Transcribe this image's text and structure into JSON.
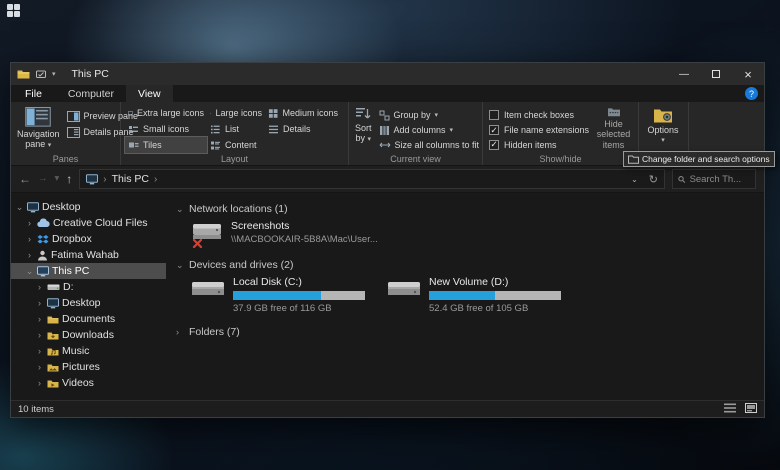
{
  "window": {
    "title": "This PC"
  },
  "tabs": {
    "file": "File",
    "computer": "Computer",
    "view": "View"
  },
  "ribbon": {
    "panes": {
      "group_label": "Panes",
      "navigation_pane": "Navigation pane",
      "preview_pane": "Preview pane",
      "details_pane": "Details pane"
    },
    "layout": {
      "group_label": "Layout",
      "extra_large_icons": "Extra large icons",
      "large_icons": "Large icons",
      "medium_icons": "Medium icons",
      "small_icons": "Small icons",
      "list": "List",
      "details": "Details",
      "tiles": "Tiles",
      "content": "Content"
    },
    "current_view": {
      "group_label": "Current view",
      "sort_by": "Sort by",
      "group_by": "Group by",
      "add_columns": "Add columns",
      "size_all_columns": "Size all columns to fit"
    },
    "show_hide": {
      "group_label": "Show/hide",
      "item_check_boxes": "Item check boxes",
      "file_name_extensions": "File name extensions",
      "hidden_items": "Hidden items",
      "hide_selected_items": "Hide selected items"
    },
    "options": {
      "label": "Options"
    }
  },
  "tooltip": {
    "text": "Change folder and search options"
  },
  "address_bar": {
    "location": "This PC",
    "search_placeholder": "Search Th..."
  },
  "sidebar": {
    "items": [
      {
        "label": "Desktop"
      },
      {
        "label": "Creative Cloud Files"
      },
      {
        "label": "Dropbox"
      },
      {
        "label": "Fatima Wahab"
      },
      {
        "label": "This PC"
      },
      {
        "label": "D:"
      },
      {
        "label": "Desktop"
      },
      {
        "label": "Documents"
      },
      {
        "label": "Downloads"
      },
      {
        "label": "Music"
      },
      {
        "label": "Pictures"
      },
      {
        "label": "Videos"
      }
    ]
  },
  "content": {
    "groups": [
      {
        "header": "Network locations (1)"
      },
      {
        "header": "Devices and drives (2)"
      },
      {
        "header": "Folders (7)"
      }
    ],
    "network_item": {
      "name": "Screenshots",
      "path": "\\\\MACBOOKAIR-5B8A\\Mac\\User..."
    },
    "drives": [
      {
        "name": "Local Disk (C:)",
        "free": "37.9 GB free of 116 GB",
        "used_pct": 67
      },
      {
        "name": "New Volume (D:)",
        "free": "52.4 GB free of 105 GB",
        "used_pct": 50
      }
    ]
  },
  "status_bar": {
    "items_count": "10 items"
  },
  "colors": {
    "accent_blue": "#26a0da",
    "selection_gray": "#4d4d4d",
    "window_bg": "#202020",
    "drive_bar_track": "#b5b5b5"
  },
  "icons": {
    "back": "←",
    "forward": "→",
    "up": "↑",
    "refresh": "↻",
    "dropdown": "⌄",
    "dropdown_small": "▾",
    "expanded": "⌄",
    "collapsed": "›",
    "breadcrumb_chevron": "›",
    "help": "?",
    "close": "×",
    "minimize": "—",
    "check": "✓"
  }
}
